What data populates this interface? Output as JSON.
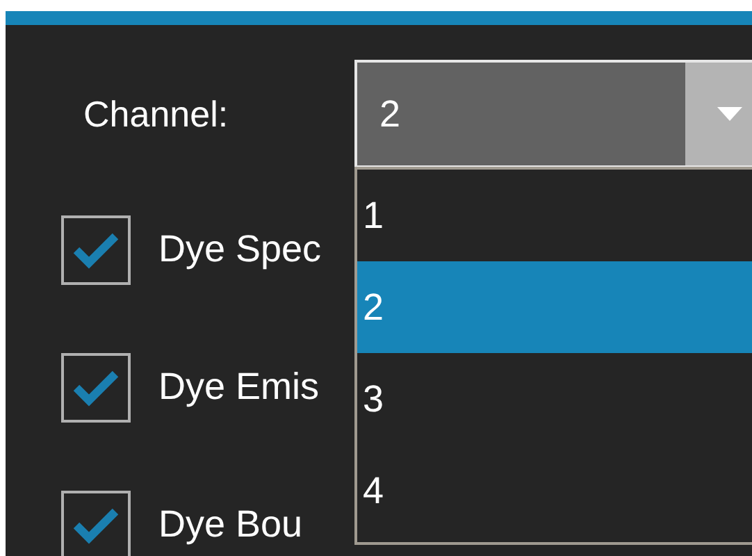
{
  "channel": {
    "label": "Channel:",
    "value": "2",
    "expanded": true,
    "options": [
      {
        "label": "1",
        "selected": false
      },
      {
        "label": "2",
        "selected": true
      },
      {
        "label": "3",
        "selected": false
      },
      {
        "label": "4",
        "selected": false
      }
    ]
  },
  "checkboxes": [
    {
      "label": "Dye Spec",
      "checked": true
    },
    {
      "label": "Dye Emis",
      "checked": true
    },
    {
      "label": "Dye Bou",
      "checked": true
    }
  ]
}
